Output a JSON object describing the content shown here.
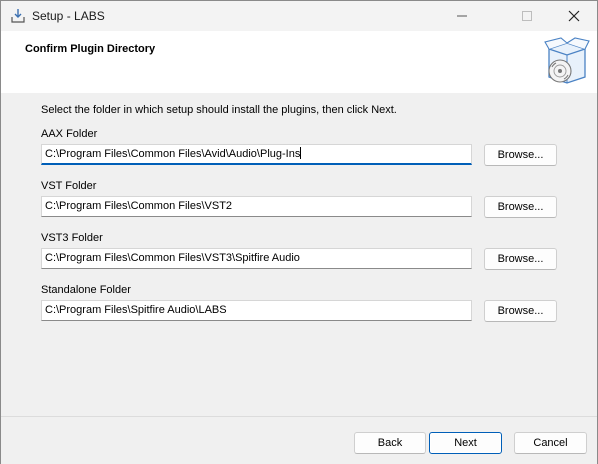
{
  "window": {
    "title": "Setup - LABS"
  },
  "header": {
    "title": "Confirm Plugin Directory",
    "icon": "software-box-icon"
  },
  "instruction": "Select the folder in which setup should install the plugins, then click Next.",
  "folders": [
    {
      "label": "AAX Folder",
      "value": "C:\\Program Files\\Common Files\\Avid\\Audio\\Plug-Ins",
      "browse": "Browse..."
    },
    {
      "label": "VST Folder",
      "value": "C:\\Program Files\\Common Files\\VST2",
      "browse": "Browse..."
    },
    {
      "label": "VST3 Folder",
      "value": "C:\\Program Files\\Common Files\\VST3\\Spitfire Audio",
      "browse": "Browse..."
    },
    {
      "label": "Standalone Folder",
      "value": "C:\\Program Files\\Spitfire Audio\\LABS",
      "browse": "Browse..."
    }
  ],
  "footer": {
    "back": "Back",
    "next": "Next",
    "cancel": "Cancel"
  },
  "colors": {
    "accent": "#005fb8",
    "header_bg": "#ffffff",
    "body_bg": "#f0f0f0"
  }
}
